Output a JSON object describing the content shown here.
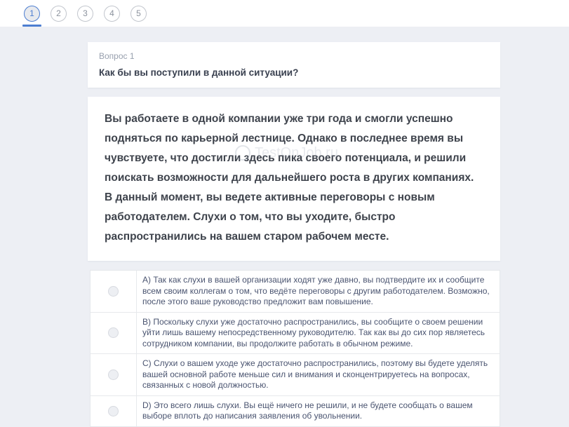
{
  "stepper": {
    "steps": [
      {
        "label": "1",
        "active": true
      },
      {
        "label": "2",
        "active": false
      },
      {
        "label": "3",
        "active": false
      },
      {
        "label": "4",
        "active": false
      },
      {
        "label": "5",
        "active": false
      }
    ]
  },
  "question": {
    "label": "Вопрос 1",
    "title": "Как бы вы поступили в данной ситуации?"
  },
  "scenario": {
    "text": "Вы работаете в одной компании уже три года и смогли успешно подняться по карьерной лестнице. Однако в последнее время вы чувствуете, что достигли здесь пика своего потенциала, и решили поискать возможности для дальнейшего роста в других компаниях. В данный момент, вы ведете активные переговоры с новым работодателем. Слухи о том, что вы уходите, быстро распространились на вашем старом рабочем месте.",
    "watermark": "TestOnJob.ru"
  },
  "options": [
    {
      "text": "A) Так как слухи в вашей организации ходят уже давно, вы подтвердите их и сообщите всем своим коллегам о том, что ведёте переговоры с другим работодателем. Возможно, после этого ваше руководство предложит вам повышение."
    },
    {
      "text": "B) Поскольку слухи уже достаточно распространились, вы сообщите о своем решении уйти лишь вашему непосредственному руководителю. Так как вы до сих пор являетесь сотрудником компании, вы продолжите работать в обычном режиме."
    },
    {
      "text": "C) Слухи о вашем уходе уже достаточно распространились, поэтому вы будете уделять вашей основной работе меньше сил и внимания и сконцентрируетесь на вопросах, связанных с новой должностью."
    },
    {
      "text": "D) Это всего лишь слухи. Вы ещё ничего не решили, и не будете сообщать о вашем выборе вплоть до написания заявления об увольнении."
    }
  ],
  "colors": {
    "accent_blue": "#4d7ed1",
    "page_background": "#edeff4",
    "option_text": "#4a5470"
  }
}
